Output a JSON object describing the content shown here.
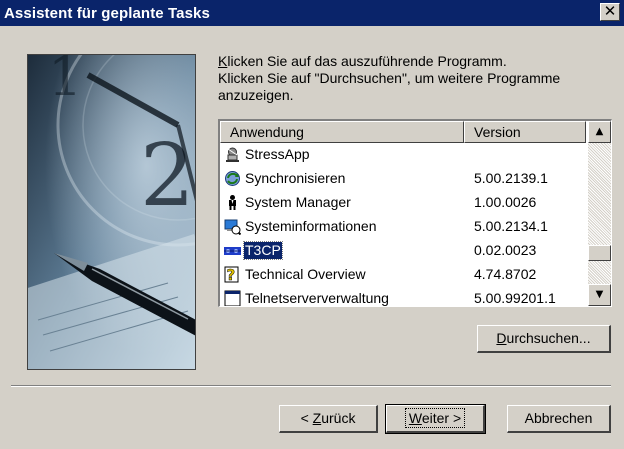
{
  "window": {
    "title": "Assistent für geplante Tasks",
    "close_glyph": "✕"
  },
  "instructions": {
    "line1_key": "K",
    "line1_rest": "licken Sie auf das auszuführende Programm.",
    "line2": "Klicken Sie auf \"Durchsuchen\", um weitere Programme",
    "line3": "anzuzeigen."
  },
  "list": {
    "columns": [
      "Anwendung",
      "Version"
    ],
    "rows": [
      {
        "name": "StressApp",
        "version": "",
        "icon": "stress-app-icon"
      },
      {
        "name": "Synchronisieren",
        "version": "5.00.2139.1",
        "icon": "sync-icon"
      },
      {
        "name": "System Manager",
        "version": "1.00.0026",
        "icon": "system-manager-icon"
      },
      {
        "name": "Systeminformationen",
        "version": "5.00.2134.1",
        "icon": "system-info-icon"
      },
      {
        "name": "T3CP",
        "version": "0.02.0023",
        "icon": "t3cp-icon",
        "selected": true
      },
      {
        "name": "Technical Overview",
        "version": "4.74.8702",
        "icon": "help-icon"
      },
      {
        "name": "Telnetserververwaltung",
        "version": "5.00.99201.1",
        "icon": "telnet-icon"
      }
    ]
  },
  "buttons": {
    "browse_key": "D",
    "browse_rest": "urchsuchen...",
    "back_pre": "< ",
    "back_key": "Z",
    "back_rest": "urück",
    "next_key": "W",
    "next_rest": "eiter >",
    "cancel": "Abbrechen"
  },
  "scroll": {
    "up_glyph": "▲",
    "down_glyph": "▼"
  }
}
